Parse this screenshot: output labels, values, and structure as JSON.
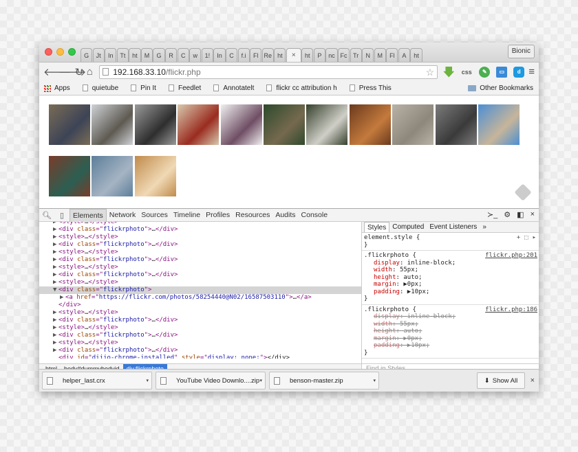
{
  "browser": {
    "tabs": [
      "G",
      "Jt",
      "In",
      "Tt",
      "ht",
      "M",
      "G",
      "R",
      "C",
      "w",
      "1!",
      "In",
      "C",
      "f.i",
      "Fl",
      "Re",
      "ht",
      "ht",
      "P",
      "nc",
      "Fc",
      "Tr",
      "N",
      "M",
      "Fl",
      "A",
      "ht"
    ],
    "active_tab_close": "×",
    "profile": "Bionic",
    "address": {
      "host": "192.168.33.10",
      "path": "/flickr.php"
    },
    "ext_css_label": "css",
    "bookmarks": [
      "Apps",
      "quietube",
      "Pin It",
      "Feedlet",
      "Annotatelt",
      "flickr cc attribution h",
      "Press This"
    ],
    "other_bookmarks": "Other Bookmarks"
  },
  "page": {
    "photos_row1": [
      {
        "name": "street-scene",
        "c1": "#7a6c55",
        "c2": "#3d4456"
      },
      {
        "name": "tree-branches",
        "c1": "#cfd2d6",
        "c2": "#5e5a52"
      },
      {
        "name": "cat-bw",
        "c1": "#9a9a9a",
        "c2": "#2e2e2e"
      },
      {
        "name": "man-red-shirt",
        "c1": "#d8c9ad",
        "c2": "#9a2c20"
      },
      {
        "name": "photographer",
        "c1": "#f0f0f0",
        "c2": "#6f4e64"
      },
      {
        "name": "park-bench",
        "c1": "#2d4a2b",
        "c2": "#75694f"
      },
      {
        "name": "dandelion",
        "c1": "#36402c",
        "c2": "#cfcfc7"
      },
      {
        "name": "dome-ceiling",
        "c1": "#6b3a1e",
        "c2": "#c47a3c"
      },
      {
        "name": "shell-sand",
        "c1": "#b8b2a7",
        "c2": "#8d877c"
      },
      {
        "name": "building-facade",
        "c1": "#7b7b7b",
        "c2": "#3a3a3a"
      },
      {
        "name": "columns-sky",
        "c1": "#4b8fd4",
        "c2": "#c7b59a"
      }
    ],
    "photos_row2": [
      {
        "name": "arched-door",
        "c1": "#7a3c2a",
        "c2": "#2b5f52"
      },
      {
        "name": "glass-building",
        "c1": "#5d7e9a",
        "c2": "#a5b4c3"
      },
      {
        "name": "window",
        "c1": "#c08a4b",
        "c2": "#f0d9b5"
      }
    ]
  },
  "devtools": {
    "tabs": [
      "Elements",
      "Network",
      "Sources",
      "Timeline",
      "Profiles",
      "Resources",
      "Audits",
      "Console"
    ],
    "dom": [
      {
        "indent": 1,
        "tri": "▶",
        "html": "<style>…</style>",
        "cut": true
      },
      {
        "indent": 1,
        "tri": "▶",
        "kind": "div",
        "rest": "…</div>"
      },
      {
        "indent": 1,
        "tri": "▶",
        "kind": "style"
      },
      {
        "indent": 1,
        "tri": "▶",
        "kind": "div",
        "rest": "…</div>"
      },
      {
        "indent": 1,
        "tri": "▶",
        "kind": "style"
      },
      {
        "indent": 1,
        "tri": "▶",
        "kind": "div",
        "rest": "…</div>"
      },
      {
        "indent": 1,
        "tri": "▶",
        "kind": "style"
      },
      {
        "indent": 1,
        "tri": "▶",
        "kind": "div",
        "rest": "…</div>"
      },
      {
        "indent": 1,
        "tri": "▶",
        "kind": "style"
      },
      {
        "indent": 1,
        "tri": "▼",
        "kind": "div",
        "rest": "",
        "selected": true
      },
      {
        "indent": 2,
        "tri": "▶",
        "kind": "a"
      },
      {
        "indent": 1,
        "tri": "",
        "kind": "close"
      },
      {
        "indent": 1,
        "tri": "▶",
        "kind": "style"
      },
      {
        "indent": 1,
        "tri": "▶",
        "kind": "div",
        "rest": "…</div>"
      },
      {
        "indent": 1,
        "tri": "▶",
        "kind": "style"
      },
      {
        "indent": 1,
        "tri": "▶",
        "kind": "div",
        "rest": "…</div>"
      },
      {
        "indent": 1,
        "tri": "▶",
        "kind": "style"
      },
      {
        "indent": 1,
        "tri": "▶",
        "kind": "div",
        "rest": "…</div>"
      },
      {
        "indent": 1,
        "tri": "",
        "kind": "chrome"
      }
    ],
    "text": {
      "div_class": "flickrphoto",
      "a_href": "https://flickr.com/photos/58254440@N02/16587503110",
      "chrome_id": "dijjo-chrome-installed",
      "chrome_style": "display: none;"
    },
    "breadcrumbs": [
      "html",
      "body#dummybodyid",
      "div.flickrphoto"
    ],
    "styles_tabs": [
      "Styles",
      "Computed",
      "Event Listeners",
      "»"
    ],
    "element_style": {
      "selector": "element.style {",
      "close": "}"
    },
    "rule1": {
      "selector": ".flickrphoto {",
      "source": "flickr.php:201",
      "props": [
        [
          "display",
          "inline-block;"
        ],
        [
          "width",
          "55px;"
        ],
        [
          "height",
          "auto;"
        ],
        [
          "margin",
          "▶0px;"
        ],
        [
          "padding",
          "▶10px;"
        ]
      ],
      "close": "}"
    },
    "rule2": {
      "selector": ".flickrphoto {",
      "source": "flickr.php:186",
      "props": [
        [
          "display",
          "inline-block;"
        ],
        [
          "width",
          "55px;"
        ],
        [
          "height",
          "auto;"
        ],
        [
          "margin",
          "▶0px;"
        ],
        [
          "padding",
          "▶10px;"
        ]
      ],
      "close": "}"
    },
    "find_placeholder": "Find in Styles"
  },
  "downloads": {
    "items": [
      "helper_last.crx",
      "YouTube Video Downlo....zip",
      "benson-master.zip"
    ],
    "show_all": "Show All"
  }
}
